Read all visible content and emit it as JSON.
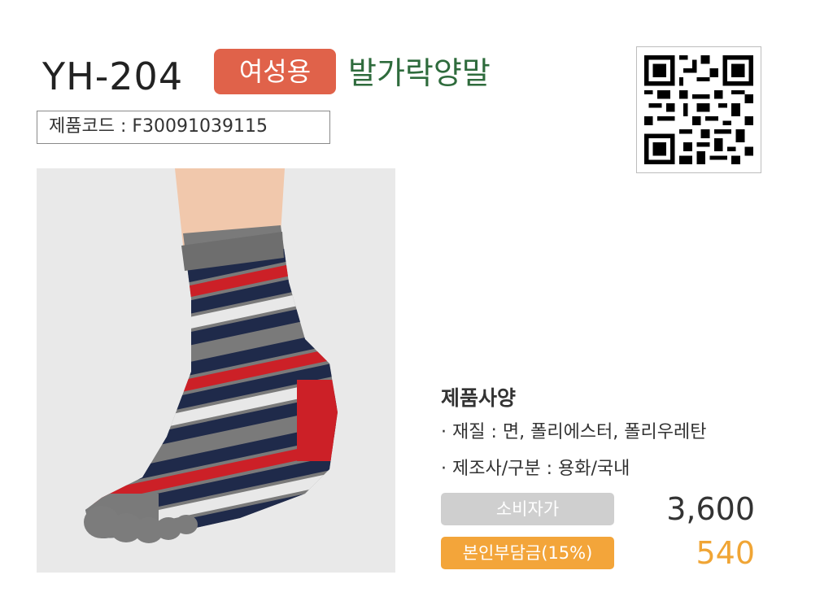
{
  "product": {
    "model": "YH-204",
    "badge": "여성용",
    "kind": "발가락양말",
    "code_label": "제품코드 : F30091039115"
  },
  "spec": {
    "title": "제품사양",
    "material": "· 재질 : 면, 폴리에스터, 폴리우레탄",
    "maker": "· 제조사/구분 : 용화/국내"
  },
  "price": {
    "retail_label": "소비자가",
    "retail_value": "3,600",
    "burden_label": "본인부담금(15%)",
    "burden_value": "540"
  },
  "icons": [
    "qr-code-icon"
  ],
  "colors": {
    "badge": "#e0624a",
    "kind_text": "#2e6b3c",
    "burden_accent": "#f3a53a",
    "retail_pill": "#cfcfcf"
  }
}
